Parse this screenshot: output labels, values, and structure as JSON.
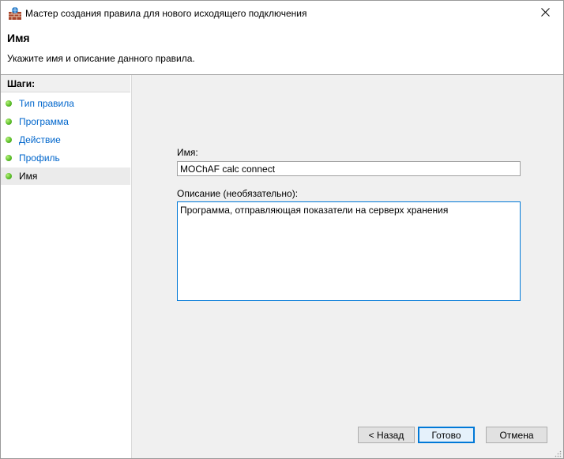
{
  "window": {
    "title": "Мастер создания правила для нового исходящего подключения",
    "icon": "firewall-wall-icon",
    "close_icon": "close-icon"
  },
  "header": {
    "title": "Имя",
    "description": "Укажите имя и описание данного правила."
  },
  "sidebar": {
    "heading": "Шаги:",
    "steps": [
      {
        "label": "Тип правила",
        "current": false
      },
      {
        "label": "Программа",
        "current": false
      },
      {
        "label": "Действие",
        "current": false
      },
      {
        "label": "Профиль",
        "current": false
      },
      {
        "label": "Имя",
        "current": true
      }
    ]
  },
  "form": {
    "name_label": "Имя:",
    "name_value": "MOChAF calc connect",
    "description_label": "Описание (необязательно):",
    "description_value": "Программа, отправляющая показатели на серверх хранения"
  },
  "buttons": {
    "back": "< Назад",
    "finish": "Готово",
    "cancel": "Отмена"
  },
  "colors": {
    "link": "#0066cc",
    "focus_border": "#0078d7",
    "step_dot": "#5cbf2a",
    "panel_bg": "#f0f0f0"
  }
}
